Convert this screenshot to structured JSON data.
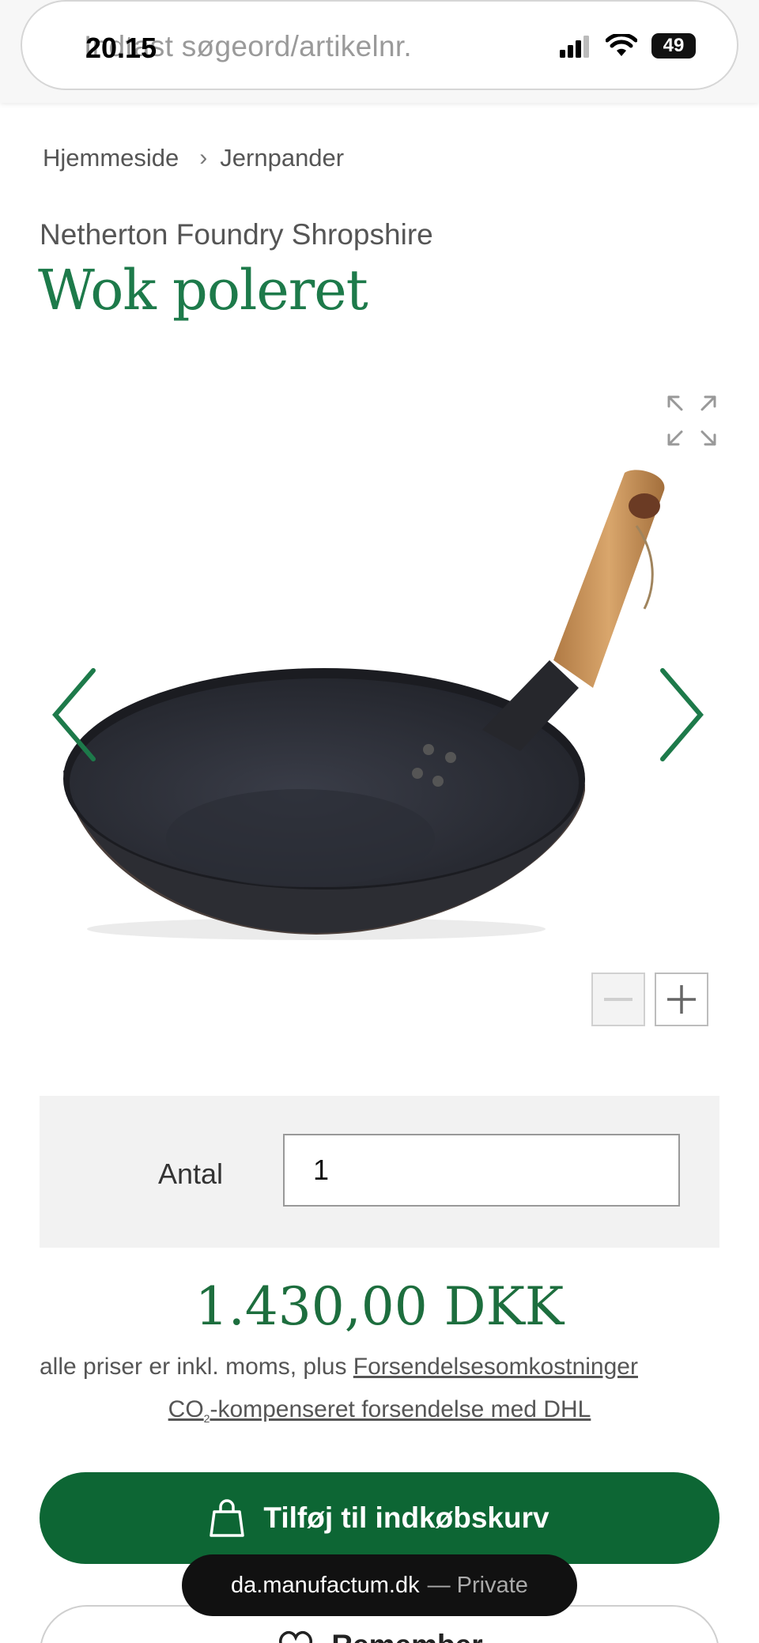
{
  "status_bar": {
    "time": "20.15",
    "battery": "49"
  },
  "search": {
    "placeholder": "Indtast søgeord/artikelnr."
  },
  "breadcrumb": {
    "home": "Hjemmeside",
    "category": "Jernpander"
  },
  "product": {
    "brand": "Netherton Foundry Shropshire",
    "title": "Wok poleret"
  },
  "quantity": {
    "label": "Antal",
    "value": "1"
  },
  "pricing": {
    "price": "1.430,00 DKK",
    "note": "alle priser er inkl. moms, plus",
    "shipping_link": "Forsendelsesomkostninger",
    "co2_prefix": "CO",
    "co2_sub": "2",
    "co2_rest": "-kompenseret forsendelse med DHL"
  },
  "actions": {
    "add_to_cart": "Tilføj til indkøbskurv",
    "remember": "Remember"
  },
  "browser": {
    "domain": "da.manufactum.dk",
    "mode": "— Private"
  },
  "colors": {
    "brand_green": "#0d6634",
    "title_green": "#1d7a4a"
  }
}
